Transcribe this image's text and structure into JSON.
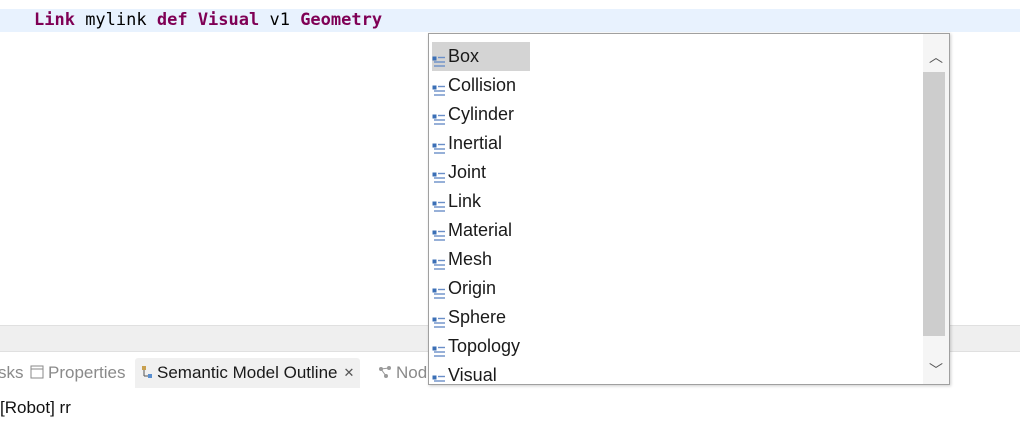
{
  "editor": {
    "code_tokens": [
      {
        "text": "Link",
        "style": "kw"
      },
      {
        "text": " mylink ",
        "style": "plain"
      },
      {
        "text": "def",
        "style": "kw"
      },
      {
        "text": " ",
        "style": "plain"
      },
      {
        "text": "Visual",
        "style": "kw"
      },
      {
        "text": " v1 ",
        "style": "plain"
      },
      {
        "text": "Geometry",
        "style": "kw"
      }
    ],
    "scroll_glyph": "‹"
  },
  "tabs": [
    {
      "label": "sks",
      "icon": "tasks-icon",
      "active": false
    },
    {
      "label": "Properties",
      "icon": "properties-icon",
      "active": false
    },
    {
      "label": "Semantic Model Outline",
      "icon": "tree-icon",
      "active": true,
      "close": "✕"
    },
    {
      "label": "Nod",
      "icon": "nodes-icon",
      "active": false
    }
  ],
  "outline": {
    "root_label": "[Robot] rr"
  },
  "popup": {
    "items": [
      {
        "label": "Box",
        "icon": "template-icon",
        "selected": true
      },
      {
        "label": "Collision",
        "icon": "template-icon",
        "selected": false
      },
      {
        "label": "Cylinder",
        "icon": "template-icon",
        "selected": false
      },
      {
        "label": "Inertial",
        "icon": "template-icon",
        "selected": false
      },
      {
        "label": "Joint",
        "icon": "template-icon",
        "selected": false
      },
      {
        "label": "Link",
        "icon": "template-icon",
        "selected": false
      },
      {
        "label": "Material",
        "icon": "template-icon",
        "selected": false
      },
      {
        "label": "Mesh",
        "icon": "template-icon",
        "selected": false
      },
      {
        "label": "Origin",
        "icon": "template-icon",
        "selected": false
      },
      {
        "label": "Sphere",
        "icon": "template-icon",
        "selected": false
      },
      {
        "label": "Topology",
        "icon": "template-icon",
        "selected": false
      },
      {
        "label": "Visual",
        "icon": "template-icon",
        "selected": false
      }
    ],
    "scroll_up": "︿",
    "scroll_down": "﹀"
  },
  "colors": {
    "keyword": "#7f0055",
    "current_line": "#e8f2fe",
    "selection": "#d4d4d4",
    "icon_blue": "#3b6fb6"
  }
}
